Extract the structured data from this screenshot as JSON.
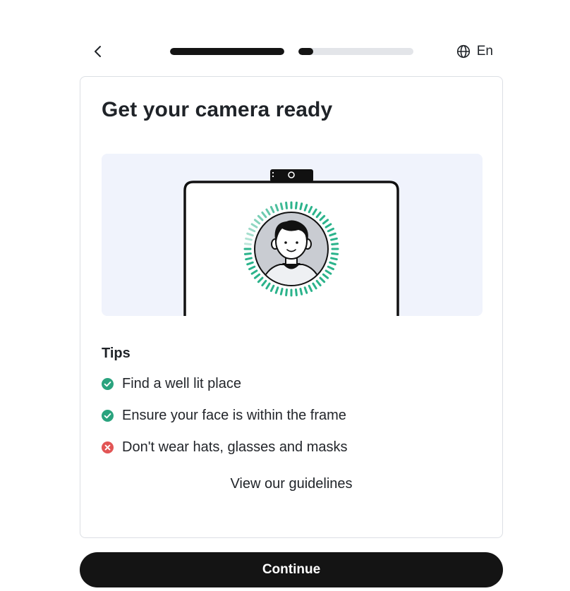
{
  "header": {
    "back_icon": "chevron-left-icon",
    "progress": [
      {
        "name": "step-1",
        "fraction": 1.0
      },
      {
        "name": "step-2",
        "fraction": 0.13
      }
    ],
    "language_icon": "globe-icon",
    "language_label": "En"
  },
  "card": {
    "title": "Get your camera ready",
    "illustration_icon": "phone-face-scan-illustration",
    "tips_heading": "Tips",
    "tips": [
      {
        "status": "ok",
        "icon": "check-circle-icon",
        "text": "Find a well lit place"
      },
      {
        "status": "ok",
        "icon": "check-circle-icon",
        "text": "Ensure your face is within the frame"
      },
      {
        "status": "bad",
        "icon": "x-circle-icon",
        "text": "Don't wear hats, glasses and masks"
      }
    ],
    "guidelines_link": "View our guidelines"
  },
  "footer": {
    "continue_label": "Continue"
  },
  "colors": {
    "primary": "#141414",
    "progress_track": "#e3e5e9",
    "success": "#2aa37e",
    "error": "#e25555",
    "illustration_bg": "#f0f3fc",
    "scan_ring": "#2bb38b"
  }
}
